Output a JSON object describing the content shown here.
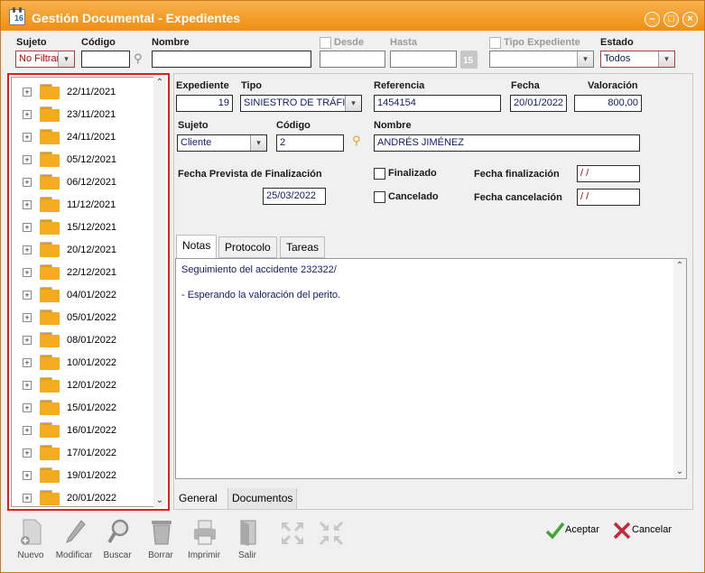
{
  "window": {
    "title": "Gestión Documental - Expedientes",
    "app_icon_number": "16",
    "accent": "#f29a1f"
  },
  "filters": {
    "sujeto_label": "Sujeto",
    "sujeto_value": "No Filtrar",
    "codigo_label": "Código",
    "codigo_value": "",
    "nombre_label": "Nombre",
    "nombre_value": "",
    "desde_label": "Desde",
    "desde_value": "",
    "hasta_label": "Hasta",
    "hasta_value": "",
    "calendar_day": "15",
    "tipo_expediente_label": "Tipo Expediente",
    "tipo_expediente_value": "",
    "estado_label": "Estado",
    "estado_value": "Todos"
  },
  "tree": {
    "items": [
      "22/11/2021",
      "23/11/2021",
      "24/11/2021",
      "05/12/2021",
      "06/12/2021",
      "11/12/2021",
      "15/12/2021",
      "20/12/2021",
      "22/12/2021",
      "04/01/2022",
      "05/01/2022",
      "08/01/2022",
      "10/01/2022",
      "12/01/2022",
      "15/01/2022",
      "16/01/2022",
      "17/01/2022",
      "19/01/2022",
      "20/01/2022"
    ]
  },
  "form": {
    "expediente_label": "Expediente",
    "expediente_value": "19",
    "tipo_label": "Tipo",
    "tipo_value": "SINIESTRO DE TRÁFICO",
    "referencia_label": "Referencia",
    "referencia_value": "1454154",
    "fecha_label": "Fecha",
    "fecha_value": "20/01/2022",
    "valoracion_label": "Valoración",
    "valoracion_value": "800,00",
    "sujeto_label": "Sujeto",
    "sujeto_value": "Cliente",
    "codigo_label": "Código",
    "codigo_value": "2",
    "nombre_label": "Nombre",
    "nombre_value": "ANDRÉS JIMÉNEZ",
    "fecha_prevista_label": "Fecha Prevista de Finalización",
    "fecha_prevista_value": "25/03/2022",
    "finalizado_label": "Finalizado",
    "cancelado_label": "Cancelado",
    "fecha_finalizacion_label": "Fecha finalización",
    "fecha_finalizacion_value": " / /",
    "fecha_cancelacion_label": "Fecha cancelación",
    "fecha_cancelacion_value": " / /"
  },
  "tabs": {
    "notas": "Notas",
    "protocolo": "Protocolo",
    "tareas": "Tareas"
  },
  "notes": {
    "line1": "Seguimiento del accidente 232322/",
    "line2": "- Esperando la valoración del perito."
  },
  "bottom_tabs": {
    "general": "General",
    "documentos": "Documentos"
  },
  "toolbar": {
    "nuevo": "Nuevo",
    "modificar": "Modificar",
    "buscar": "Buscar",
    "borrar": "Borrar",
    "imprimir": "Imprimir",
    "salir": "Salir"
  },
  "actions": {
    "aceptar": "Aceptar",
    "cancelar": "Cancelar"
  }
}
